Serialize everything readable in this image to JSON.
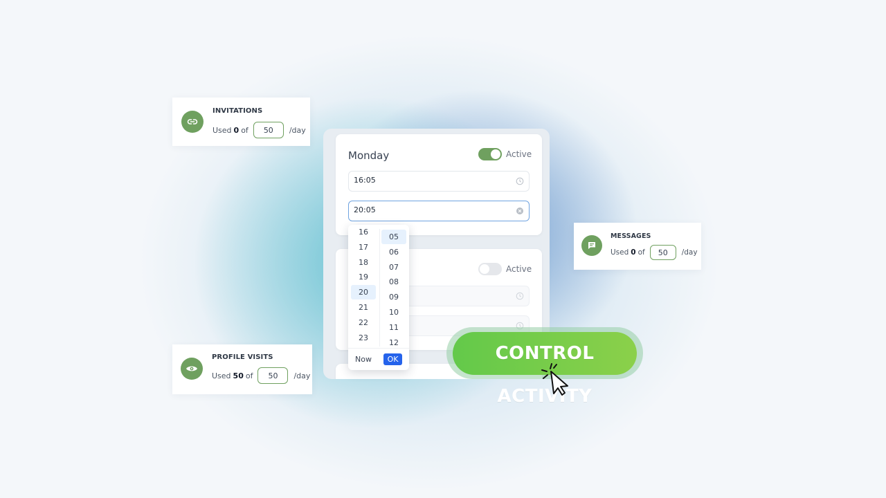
{
  "colors": {
    "accent_green": "#6fa05f",
    "primary_blue": "#2563eb",
    "cta_green": "#7acb4b"
  },
  "invitations": {
    "title": "INVITATIONS",
    "used_prefix": "Used",
    "used": "0",
    "of": "of",
    "limit": "50",
    "unit": "/day",
    "icon": "link-icon"
  },
  "messages": {
    "title": "MESSAGES",
    "used_prefix": "Used",
    "used": "0",
    "of": "of",
    "limit": "50",
    "unit": "/day",
    "icon": "chat-icon"
  },
  "profile_visits": {
    "title": "PROFILE VISITS",
    "used_prefix": "Used",
    "used": "50",
    "of": "of",
    "limit": "50",
    "unit": "/day",
    "icon": "eye-icon"
  },
  "schedule": {
    "monday": {
      "day": "Monday",
      "toggle_label": "Active",
      "active": true,
      "start_time": "16:05",
      "end_time": "20:05"
    },
    "second_day": {
      "toggle_label": "Active",
      "active": false
    }
  },
  "picker": {
    "hours": [
      "16",
      "17",
      "18",
      "19",
      "20",
      "21",
      "22",
      "23"
    ],
    "selected_hour": "20",
    "minutes": [
      "05",
      "06",
      "07",
      "08",
      "09",
      "10",
      "11",
      "12"
    ],
    "selected_minute": "05",
    "now_label": "Now",
    "ok_label": "OK"
  },
  "cta": {
    "label": "CONTROL ACTIVITY"
  }
}
